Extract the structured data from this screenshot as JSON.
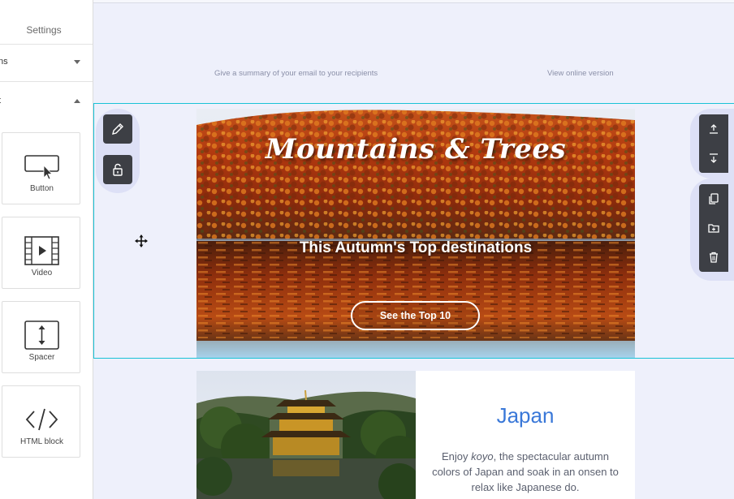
{
  "sidebar": {
    "title": "Settings",
    "rows": [
      {
        "label": "ns",
        "state": "collapsed"
      },
      {
        "label": "t",
        "state": "expanded"
      }
    ],
    "blocks": [
      {
        "label": "Button",
        "icon": "button-cursor-icon"
      },
      {
        "label": "Video",
        "icon": "film-play-icon"
      },
      {
        "label": "Spacer",
        "icon": "vertical-spacer-icon"
      },
      {
        "label": "HTML block",
        "icon": "code-brackets-icon"
      }
    ]
  },
  "preheader": {
    "summary": "Give a summary of your email to your recipients",
    "online": "View online version"
  },
  "hero": {
    "script_title": "Mountains & Trees",
    "headline": "This Autumn's Top destinations",
    "button_label": "See the Top 10"
  },
  "left_tools": [
    "pencil-icon",
    "unlock-icon"
  ],
  "right_tools": [
    "move-up-icon",
    "move-down-icon",
    "duplicate-icon",
    "save-folder-icon",
    "trash-icon"
  ],
  "japan": {
    "title": "Japan",
    "body_before": "Enjoy ",
    "body_em": "koyo",
    "body_after": ", the spectacular autumn colors of Japan and soak in an onsen to relax like Japanese do."
  },
  "colors": {
    "accent_cyan": "#19c2d6",
    "tool_dark": "#3d3f45",
    "japan_blue": "#3a78d8",
    "canvas_bg": "#eef0fb"
  }
}
